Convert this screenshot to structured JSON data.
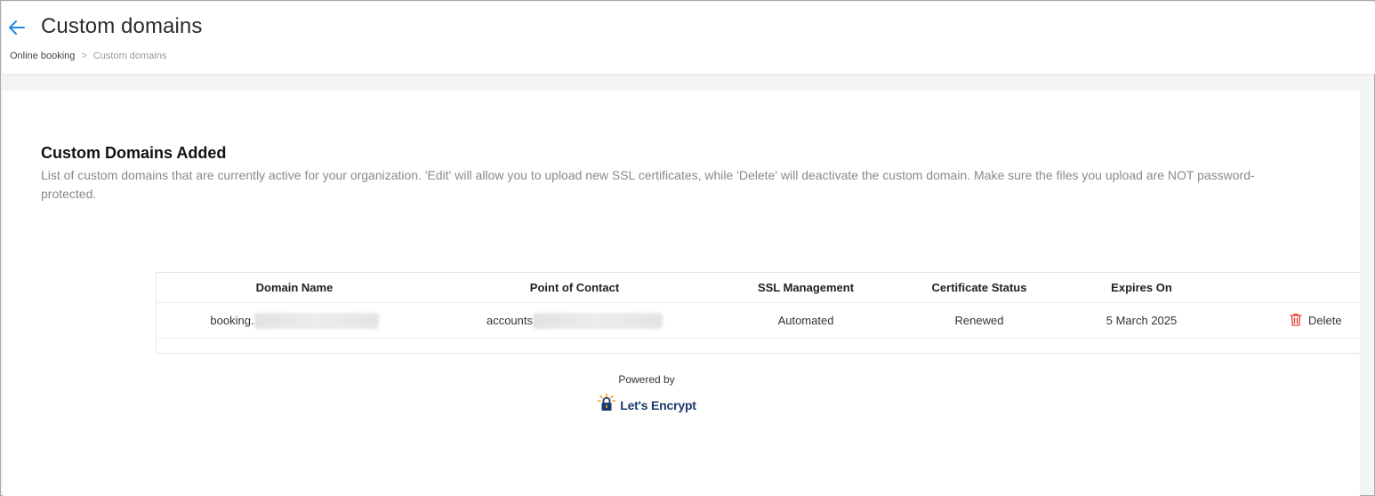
{
  "header": {
    "title": "Custom domains",
    "breadcrumb": {
      "parent": "Online booking",
      "separator": ">",
      "current": "Custom domains"
    }
  },
  "section": {
    "title": "Custom Domains Added",
    "description": "List of custom domains that are currently active for your organization. 'Edit' will allow you to upload new SSL certificates, while 'Delete' will deactivate the custom domain. Make sure the files you upload are NOT password-protected."
  },
  "table": {
    "columns": [
      "Domain Name",
      "Point of Contact",
      "SSL Management",
      "Certificate Status",
      "Expires On"
    ],
    "rows": [
      {
        "domain": "booking.",
        "contact": "accounts",
        "ssl": "Automated",
        "status": "Renewed",
        "expires": "5 March 2025",
        "action": "Delete"
      }
    ]
  },
  "footer": {
    "powered_by": "Powered by",
    "provider": "Let's Encrypt"
  },
  "colors": {
    "accent": "#1e88e5",
    "delete": "#e53935",
    "logo_blue": "#1a3a6b",
    "logo_yellow": "#f5a623"
  }
}
